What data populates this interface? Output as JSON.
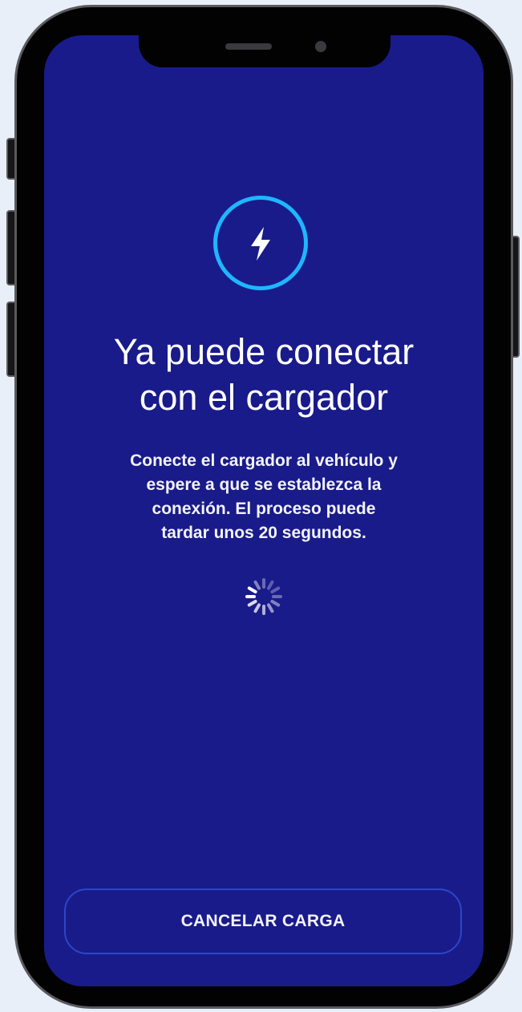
{
  "screen": {
    "icon": "lightning-bolt-icon",
    "accent_color": "#1fb6ff",
    "background_color": "#191b8a",
    "title": "Ya puede conectar\ncon el cargador",
    "description": "Conecte el cargador al vehículo y\nespere a que se establezca la\nconexión. El proceso puede\ntardar unos 20 segundos.",
    "loading_indicator": "spinner-icon"
  },
  "actions": {
    "cancel_label": "CANCELAR CARGA"
  }
}
